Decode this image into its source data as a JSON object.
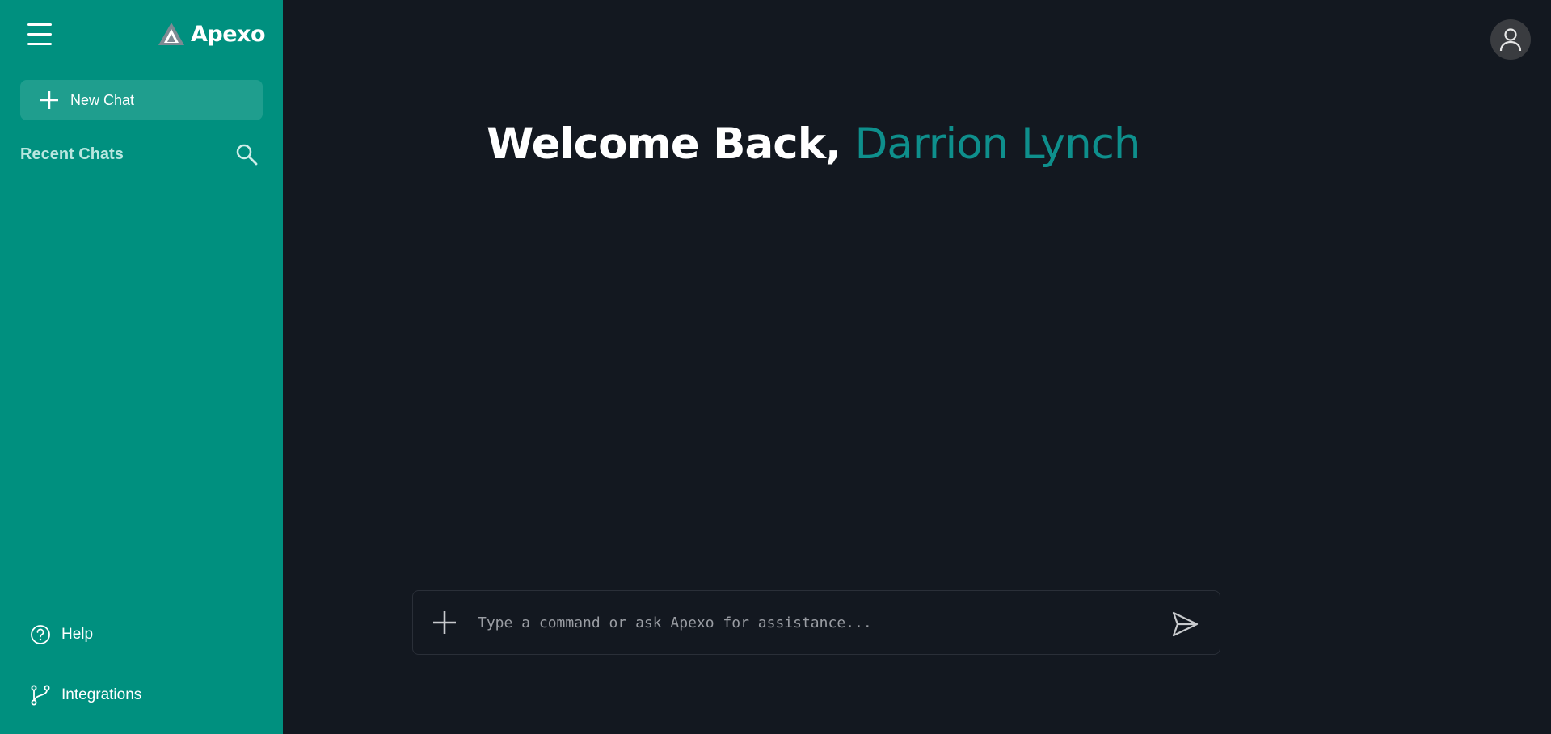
{
  "brand": {
    "name": "Apexo"
  },
  "sidebar": {
    "new_chat_label": "New Chat",
    "recent_chats_title": "Recent Chats",
    "recent_chats": [],
    "help_label": "Help",
    "integrations_label": "Integrations"
  },
  "main": {
    "welcome_prefix": "Welcome Back, ",
    "user_name": "Darrion Lynch",
    "composer_placeholder": "Type a command or ask Apexo for assistance...",
    "composer_value": ""
  },
  "icons": {
    "menu": "hamburger-menu-icon",
    "logo": "triangle-logo-icon",
    "new_chat": "plus-icon",
    "search": "search-icon",
    "help": "question-circle-icon",
    "integrations": "git-branch-icon",
    "avatar": "user-icon",
    "attach": "plus-icon",
    "send": "send-icon"
  },
  "colors": {
    "sidebar_bg": "#00907f",
    "main_bg": "#131820",
    "accent_name": "#0e8f8c",
    "new_chat_bg": "#1f9e8e"
  }
}
